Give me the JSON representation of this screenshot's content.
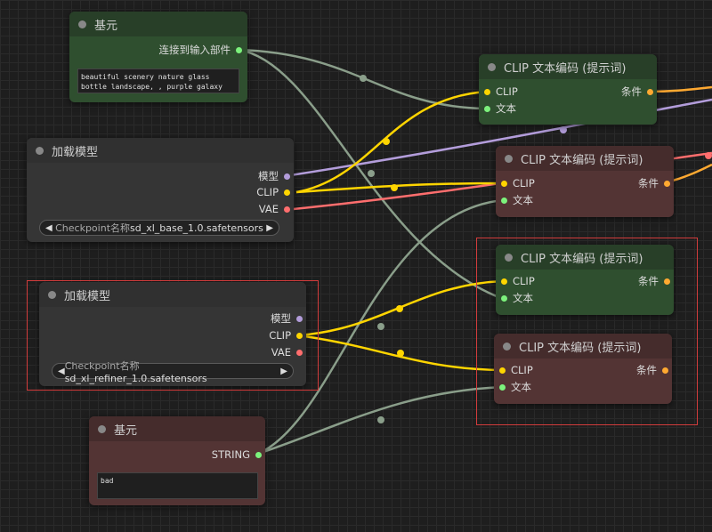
{
  "colors": {
    "clip": "#ffd500",
    "text": "#7cf27c",
    "conditioning": "#ffa931",
    "model": "#b39ddb",
    "vae": "#ff6e6e",
    "wire_gray": "#8a9e8a",
    "selection": "#d23c3c"
  },
  "primitive_top": {
    "title": "基元",
    "output_label": "连接到输入部件",
    "text": "beautiful scenery nature glass bottle landscape, , purple galaxy bottle,"
  },
  "loader_base": {
    "title": "加载模型",
    "outputs": [
      "模型",
      "CLIP",
      "VAE"
    ],
    "widget_label": "Checkpoint名称",
    "widget_value": "sd_xl_base_1.0.safetensors"
  },
  "loader_refiner": {
    "title": "加载模型",
    "outputs": [
      "模型",
      "CLIP",
      "VAE"
    ],
    "widget_label": "Checkpoint名称",
    "widget_value": "sd_xl_refiner_1.0.safetensors"
  },
  "primitive_bottom": {
    "title": "基元",
    "output_label": "STRING",
    "text": "bad"
  },
  "clip_encode_1": {
    "title": "CLIP 文本编码 (提示词)",
    "in_clip": "CLIP",
    "in_text": "文本",
    "out": "条件"
  },
  "clip_encode_2": {
    "title": "CLIP 文本编码 (提示词)",
    "in_clip": "CLIP",
    "in_text": "文本",
    "out": "条件"
  },
  "clip_encode_3": {
    "title": "CLIP 文本编码 (提示词)",
    "in_clip": "CLIP",
    "in_text": "文本",
    "out": "条件"
  },
  "clip_encode_4": {
    "title": "CLIP 文本编码 (提示词)",
    "in_clip": "CLIP",
    "in_text": "文本",
    "out": "条件"
  }
}
